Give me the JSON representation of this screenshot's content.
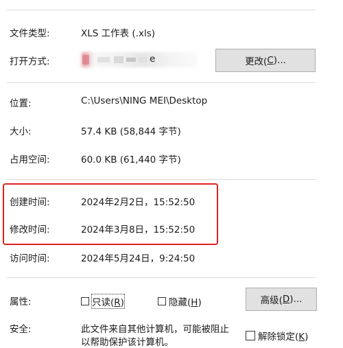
{
  "file_type": {
    "label": "文件类型:",
    "value": "XLS 工作表 (.xls)"
  },
  "open_with": {
    "label": "打开方式:",
    "app_name_tail": "e",
    "change_button": {
      "text": "更改(",
      "key": "C",
      "suffix": ")..."
    }
  },
  "location": {
    "label": "位置:",
    "value": "C:\\Users\\NING MEI\\Desktop"
  },
  "size": {
    "label": "大小:",
    "value": "57.4 KB (58,844 字节)"
  },
  "size_on_disk": {
    "label": "占用空间:",
    "value": "60.0 KB (61,440 字节)"
  },
  "created": {
    "label": "创建时间:",
    "value": "2024年2月2日，15:52:50"
  },
  "modified": {
    "label": "修改时间:",
    "value": "2024年3月8日，15:52:50"
  },
  "accessed": {
    "label": "访问时间:",
    "value": "2024年5月24日，9:24:50"
  },
  "attributes": {
    "label": "属性:",
    "readonly": {
      "text": "只读(",
      "key": "R",
      "suffix": ")",
      "checked": false
    },
    "hidden": {
      "text": "隐藏(",
      "key": "H",
      "suffix": ")",
      "checked": false
    },
    "advanced_button": {
      "text": "高级(",
      "key": "D",
      "suffix": ")..."
    }
  },
  "security": {
    "label": "安全:",
    "text_line1": "此文件来自其他计算机，可能被阻止",
    "text_line2": "以帮助保护该计算机。",
    "unblock": {
      "text": "解除锁定(",
      "key": "K",
      "suffix": ")",
      "checked": false
    }
  },
  "colors": {
    "highlight_border": "#e02020",
    "button_bg": "#e1e1e1",
    "divider": "#d9d9d9"
  }
}
